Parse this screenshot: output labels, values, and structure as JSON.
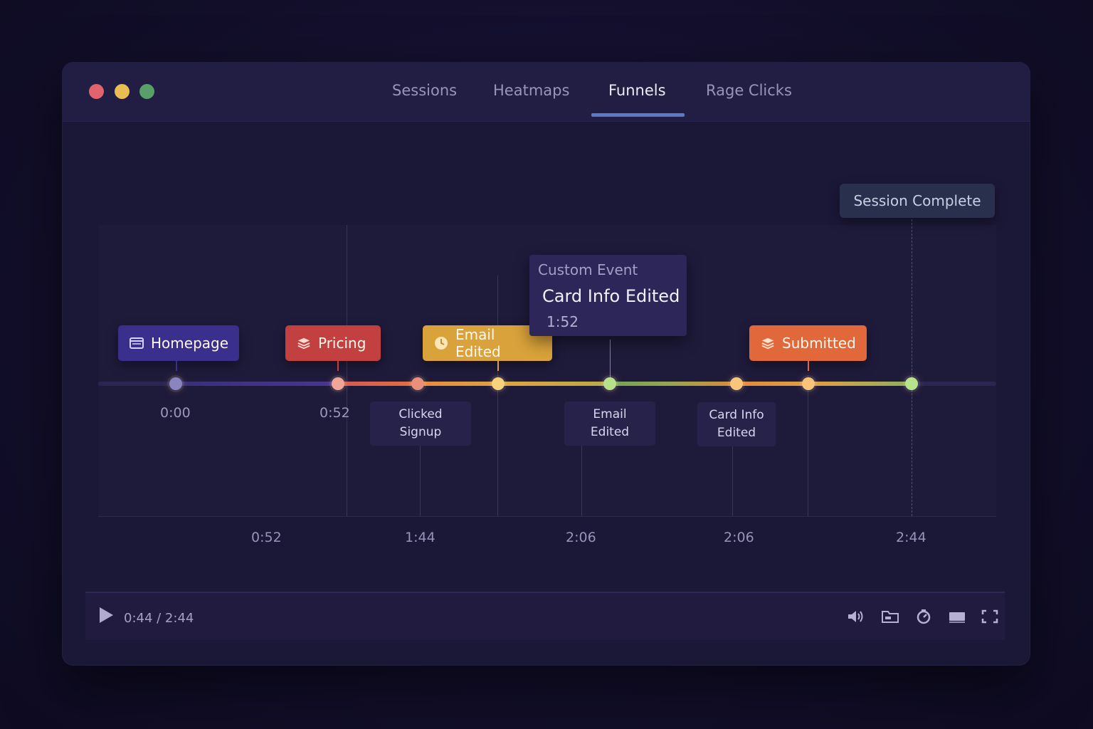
{
  "nav": {
    "tabs": [
      {
        "label": "Sessions"
      },
      {
        "label": "Heatmaps"
      },
      {
        "label": "Funnels"
      },
      {
        "label": "Rage Clicks"
      }
    ],
    "active_tab": "Funnels"
  },
  "timeline": {
    "session_complete_label": "Session Complete",
    "tooltip": {
      "heading": "Custom Event",
      "title": "Card Info Edited",
      "time": "1:52"
    },
    "pages": [
      {
        "label": "Homepage",
        "icon": "page-icon",
        "color": "#3b2f8f"
      },
      {
        "label": "Pricing",
        "icon": "card-icon",
        "color": "#c2403f"
      },
      {
        "label": "Email Edited",
        "icon": "clock-icon",
        "color": "#d9a23a"
      },
      {
        "label": "Submitted",
        "icon": "card-icon",
        "color": "#e0683a"
      }
    ],
    "time_labels": [
      "0:00",
      "0:52"
    ],
    "events": [
      {
        "label": "Clicked Signup"
      },
      {
        "label": "Email Edited"
      },
      {
        "label": "Card Info Edited"
      }
    ],
    "axis_ticks": [
      "0:52",
      "1:44",
      "2:06",
      "2:06",
      "2:44"
    ]
  },
  "player": {
    "time_display": "0:44 / 2:44",
    "icons": [
      "volume-icon",
      "folder-icon",
      "speed-icon",
      "screen-icon",
      "fullscreen-icon"
    ]
  }
}
